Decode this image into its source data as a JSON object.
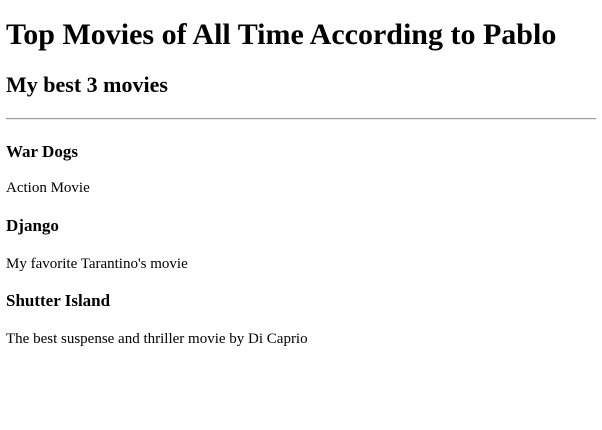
{
  "page": {
    "title": "Top Movies of All Time According to Pablo",
    "subtitle": "My best 3 movies"
  },
  "movies": [
    {
      "title": "War Dogs",
      "description": "Action Movie"
    },
    {
      "title": "Django",
      "description": "My favorite Tarantino's movie"
    },
    {
      "title": "Shutter Island",
      "description": "The best suspense and thriller movie by Di Caprio"
    }
  ]
}
